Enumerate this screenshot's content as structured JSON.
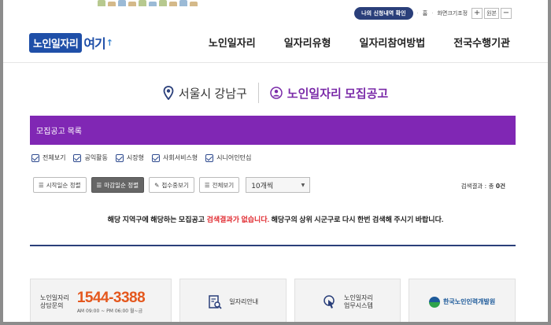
{
  "util": {
    "my_applications": "나의 신청내역 확인",
    "home": "홈",
    "screen_size": "화면크기조정",
    "zoom_in": "+",
    "zoom_label": "원본",
    "zoom_out": "−"
  },
  "logo": {
    "main": "노인일자리",
    "sub": "여기",
    "mark": "↑"
  },
  "nav": [
    "노인일자리",
    "일자리유형",
    "일자리참여방법",
    "전국수행기관"
  ],
  "region": {
    "location": "서울시 강남구",
    "notice": "노인일자리 모집공고"
  },
  "list_bar": {
    "title": "모집공고 목록"
  },
  "filters": [
    "전체보기",
    "공익활동",
    "시장형",
    "사회서비스형",
    "시니어인턴십"
  ],
  "toolbar": {
    "sort_start": "시작일순 정렬",
    "sort_deadline": "마감일순 정렬",
    "accepting": "접수중보기",
    "view_all": "전체보기",
    "page_size": "10개씩"
  },
  "result": {
    "label": "검색결과 : 총",
    "count": "0건"
  },
  "empty": {
    "before": "해당 지역구에 해당하는 모집공고",
    "highlight": "검색결과가 없습니다.",
    "after": "해당구의 상위 시군구로 다시 한번 검색해 주시기 바랍니다."
  },
  "banners": {
    "call_label_1": "노인일자리",
    "call_label_2": "상담문의",
    "call_number": "1544-3388",
    "call_hours": "AM 09:00 ~ PM 06:00 월~금",
    "job_info": "일자리안내",
    "system_1": "노인일자리",
    "system_2": "업무시스템",
    "agency": "한국노인인력개발원"
  },
  "colors": {
    "purple": "#8027b4",
    "navy": "#2a3f7a",
    "orange": "#e4571d",
    "red": "#e0282e"
  }
}
